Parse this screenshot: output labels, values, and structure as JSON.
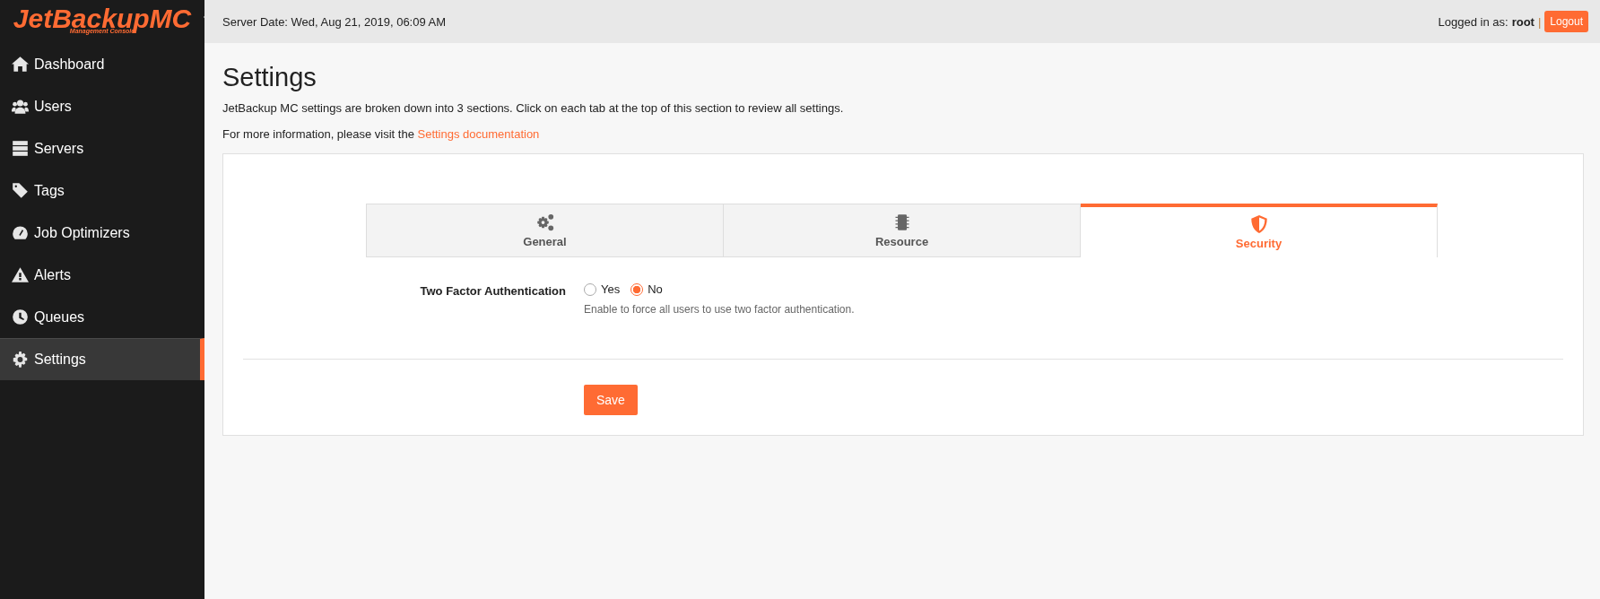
{
  "logo": {
    "title": "JetBackupMC",
    "subtitle": "Management Console"
  },
  "sidebar": {
    "items": [
      {
        "label": "Dashboard",
        "selected": false
      },
      {
        "label": "Users",
        "selected": false
      },
      {
        "label": "Servers",
        "selected": false
      },
      {
        "label": "Tags",
        "selected": false
      },
      {
        "label": "Job Optimizers",
        "selected": false
      },
      {
        "label": "Alerts",
        "selected": false
      },
      {
        "label": "Queues",
        "selected": false
      },
      {
        "label": "Settings",
        "selected": true
      }
    ]
  },
  "header": {
    "server_date": "Server Date: Wed, Aug 21, 2019, 06:09 AM",
    "logged_in_label": "Logged in as:",
    "user": "root",
    "separator": "|",
    "logout": "Logout"
  },
  "page": {
    "title": "Settings",
    "intro": "JetBackup MC settings are broken down into 3 sections. Click on each tab at the top of this section to review all settings.",
    "more_info": "For more information, please visit the",
    "doc_link": "Settings documentation"
  },
  "tabs": [
    {
      "label": "General",
      "selected": false
    },
    {
      "label": "Resource",
      "selected": false
    },
    {
      "label": "Security",
      "selected": true
    }
  ],
  "form": {
    "fields": [
      {
        "label": "Two Factor Authentication",
        "options": [
          {
            "label": "Yes",
            "selected": false
          },
          {
            "label": "No",
            "selected": true
          }
        ],
        "help": "Enable to force all users to use two factor authentication."
      }
    ],
    "save": "Save"
  }
}
